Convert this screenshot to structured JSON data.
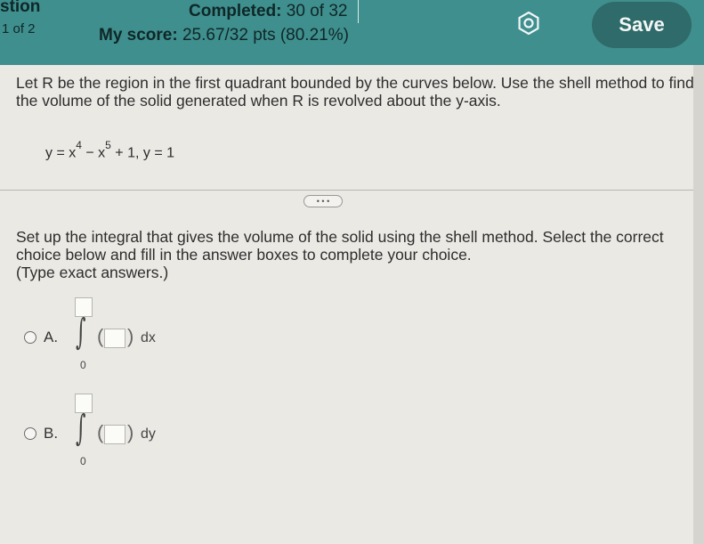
{
  "header": {
    "question_label": "stion",
    "part_of": "1 of 2",
    "completed_label": "Completed:",
    "completed_value": "30 of 32",
    "score_label": "My score:",
    "score_value": "25.67/32 pts (80.21%)",
    "settings_icon": "gear-icon",
    "save_label": "Save"
  },
  "question": {
    "prompt": "Let R be the region in the first quadrant bounded by the curves below. Use the shell method to find the volume of the solid generated when R is revolved about the y-axis.",
    "eq_part1": "y = x",
    "exp1": "4",
    "eq_part2": " − x",
    "exp2": "5",
    "eq_part3": " + 1, y = 1",
    "more_label": "• • •"
  },
  "instructions": {
    "text": "Set up the integral that gives the volume of the solid using the shell method. Select the correct choice below and fill in the answer boxes to complete your choice.",
    "note": "(Type exact answers.)"
  },
  "choices": [
    {
      "label": "A.",
      "lower_limit": "0",
      "paren_open": "(",
      "paren_close": ")",
      "differential": "dx"
    },
    {
      "label": "B.",
      "lower_limit": "0",
      "paren_open": "(",
      "paren_close": ")",
      "differential": "dy"
    }
  ],
  "colors": {
    "header_bg": "#3f8f8e",
    "save_bg": "#2e6b6a",
    "content_bg": "#ebe9e4"
  }
}
